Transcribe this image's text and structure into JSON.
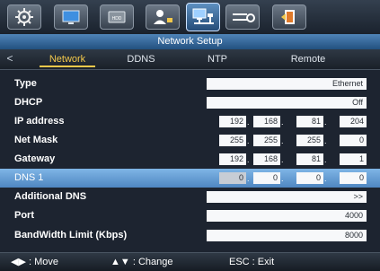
{
  "title": "Network Setup",
  "toolbar": {
    "icons": [
      "gear-icon",
      "monitor-icon",
      "hdd-icon",
      "user-icon",
      "network-icon",
      "settings-icon",
      "exit-icon"
    ],
    "active": "network-icon"
  },
  "tabs": {
    "prev_arrow": "<",
    "items": [
      {
        "label": "Network"
      },
      {
        "label": "DDNS"
      },
      {
        "label": "NTP"
      },
      {
        "label": "Remote"
      }
    ]
  },
  "rows": {
    "type": {
      "label": "Type",
      "value": "Ethernet"
    },
    "dhcp": {
      "label": "DHCP",
      "value": "Off"
    },
    "ip": {
      "label": "IP address",
      "octets": [
        "192",
        "168",
        "81",
        "204"
      ]
    },
    "mask": {
      "label": "Net Mask",
      "octets": [
        "255",
        "255",
        "255",
        "0"
      ]
    },
    "gateway": {
      "label": "Gateway",
      "octets": [
        "192",
        "168",
        "81",
        "1"
      ]
    },
    "dns1": {
      "label": "DNS 1",
      "octets": [
        "0",
        "0",
        "0",
        "0"
      ]
    },
    "additional_dns": {
      "label": "Additional DNS",
      "value": ">>"
    },
    "port": {
      "label": "Port",
      "value": "4000"
    },
    "bandwidth": {
      "label": "BandWidth Limit (Kbps)",
      "value": "8000"
    }
  },
  "status": {
    "move": "◀▶ : Move",
    "change": "▲▼ : Change",
    "exit": "ESC : Exit"
  },
  "colors": {
    "accent": "#f2c84b",
    "title_bg": "#3a6fa3",
    "selected_row": "#6ca3d8"
  }
}
